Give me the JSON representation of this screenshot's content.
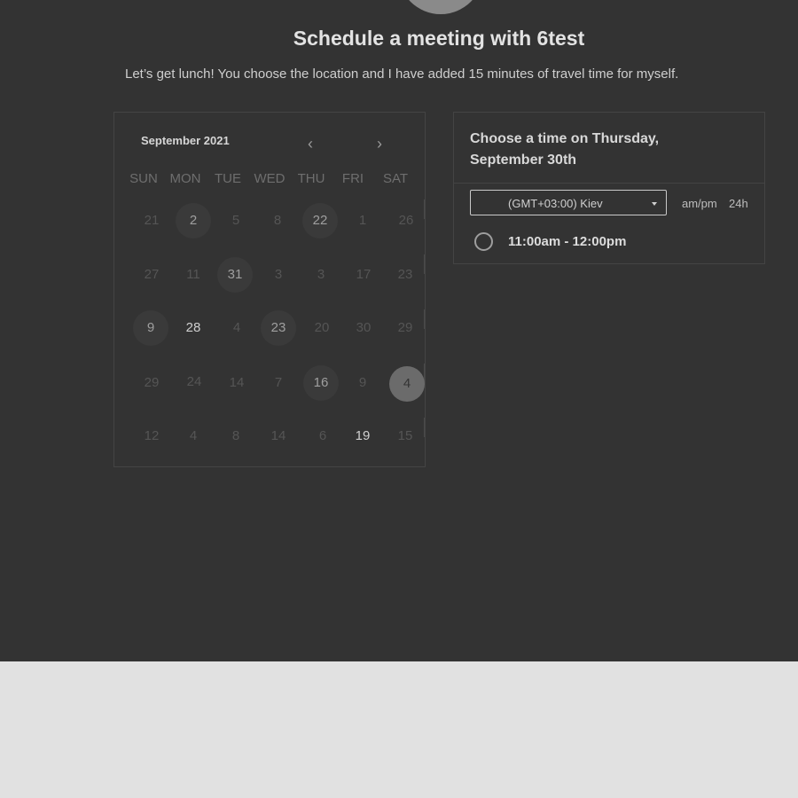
{
  "header": {
    "title": "Schedule a meeting with 6test",
    "subtitle": "Let’s get lunch! You choose the location and I have added 15 minutes of travel time for myself."
  },
  "calendar": {
    "month_label": "September 2021",
    "prev_glyph": "‹",
    "next_glyph": "›",
    "weekdays": [
      "SUN",
      "MON",
      "TUE",
      "WED",
      "THU",
      "FRI",
      "SAT"
    ],
    "rows": [
      [
        "21",
        "2",
        "5",
        "8",
        "22",
        "1",
        "26"
      ],
      [
        "27",
        "11",
        "31",
        "3",
        "3",
        "17",
        "23"
      ],
      [
        "9",
        "28",
        "4",
        "23",
        "20",
        "30",
        "29"
      ],
      [
        "29",
        "24",
        "14",
        "7",
        "16",
        "9",
        "4"
      ],
      [
        "12",
        "4",
        "8",
        "14",
        "6",
        "19",
        "15"
      ]
    ],
    "available_dates": [
      "2",
      "22",
      "31",
      "9",
      "23",
      "16"
    ],
    "selected_date": "4"
  },
  "time_panel": {
    "heading": "Choose a time on Thursday, September 30th",
    "timezone_value": "(GMT+03:00) Kiev",
    "format_ampm": "am/pm",
    "format_24h": "24h",
    "slot_label": "11:00am - 12:00pm"
  }
}
